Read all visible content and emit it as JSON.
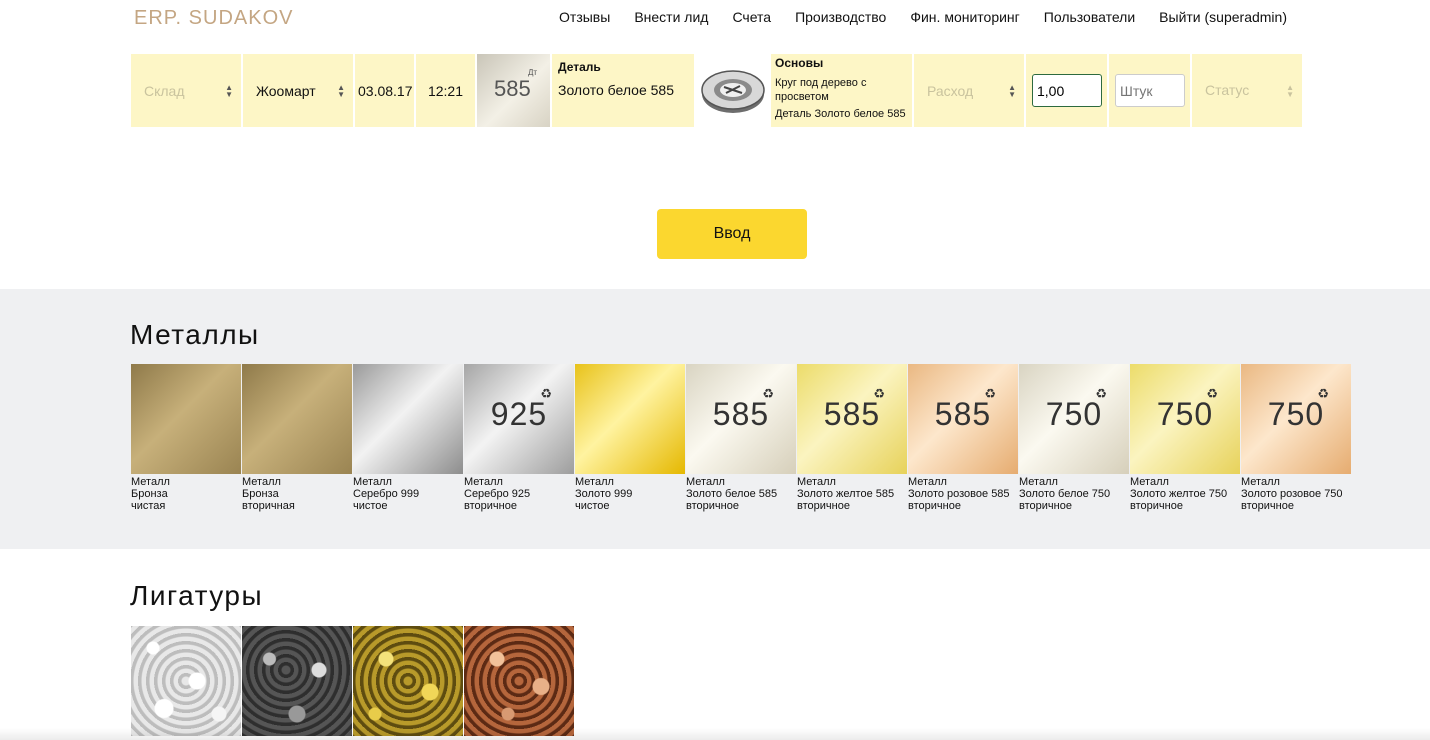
{
  "header": {
    "logo": "ERP. SUDAKOV",
    "nav": [
      "Отзывы",
      "Внести лид",
      "Счета",
      "Производство",
      "Фин. мониторинг",
      "Пользователи",
      "Выйти (superadmin)"
    ]
  },
  "order": {
    "warehouse_placeholder": "Склад",
    "employee": "Жоомарт",
    "date": "03.08.17",
    "time": "12:21",
    "thumb_number": "585",
    "thumb_small": "Дт",
    "detail_title": "Деталь",
    "detail_value": "Золото белое 585",
    "osnovy_title": "Основы",
    "osnovy_line1": "Круг под дерево с просветом",
    "osnovy_line2": "Деталь Золото белое 585",
    "type_placeholder": "Расход",
    "amount_value": "1,00",
    "pieces_placeholder": "Штук",
    "status_placeholder": "Статус"
  },
  "enter_button": "Ввод",
  "metals": {
    "title": "Металлы",
    "items": [
      {
        "l1": "Металл",
        "l2": "Бронза",
        "l3": "чистая",
        "num": "",
        "recycle": false
      },
      {
        "l1": "Металл",
        "l2": "Бронза",
        "l3": "вторичная",
        "num": "",
        "recycle": false
      },
      {
        "l1": "Металл",
        "l2": "Серебро 999",
        "l3": "чистое",
        "num": "",
        "recycle": false
      },
      {
        "l1": "Металл",
        "l2": "Серебро 925",
        "l3": "вторичное",
        "num": "925",
        "recycle": true
      },
      {
        "l1": "Металл",
        "l2": "Золото 999",
        "l3": "чистое",
        "num": "",
        "recycle": false
      },
      {
        "l1": "Металл",
        "l2": "Золото белое 585",
        "l3": "вторичное",
        "num": "585",
        "recycle": true
      },
      {
        "l1": "Металл",
        "l2": "Золото желтое 585",
        "l3": "вторичное",
        "num": "585",
        "recycle": true
      },
      {
        "l1": "Металл",
        "l2": "Золото розовое 585",
        "l3": "вторичное",
        "num": "585",
        "recycle": true
      },
      {
        "l1": "Металл",
        "l2": "Золото белое 750",
        "l3": "вторичное",
        "num": "750",
        "recycle": true
      },
      {
        "l1": "Металл",
        "l2": "Золото желтое 750",
        "l3": "вторичное",
        "num": "750",
        "recycle": true
      },
      {
        "l1": "Металл",
        "l2": "Золото розовое 750",
        "l3": "вторичное",
        "num": "750",
        "recycle": true
      }
    ]
  },
  "ligatures": {
    "title": "Лигатуры"
  }
}
